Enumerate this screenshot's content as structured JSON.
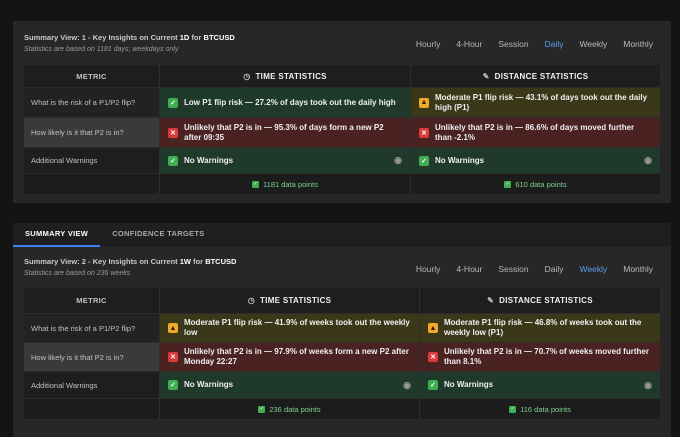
{
  "tabs": [
    {
      "label": "SUMMARY VIEW",
      "active": true
    },
    {
      "label": "CONFIDENCE TARGETS",
      "active": false
    }
  ],
  "timeframes": [
    "Hourly",
    "4-Hour",
    "Session",
    "Daily",
    "Weekly",
    "Monthly"
  ],
  "columns": {
    "metric": "METRIC",
    "time": "TIME STATISTICS",
    "distance": "DISTANCE STATISTICS"
  },
  "panels": [
    {
      "title_prefix": "Summary View: 1 - Key Insights on Current",
      "timeframe": "1D",
      "for_word": "for",
      "symbol": "BTCUSD",
      "subtitle": "Statistics are based on 1181 days; weekdays only",
      "active_timeframe": "Daily",
      "rows": [
        {
          "metric": "What is the risk of a P1/P2 flip?",
          "time": {
            "status": "ok",
            "text": "Low P1 flip risk — 27.2% of days took out the daily high"
          },
          "distance": {
            "status": "warn",
            "text": "Moderate P1 flip risk — 43.1% of days took out the daily high (P1)"
          }
        },
        {
          "metric": "How likely is it that P2 is in?",
          "time": {
            "status": "bad",
            "text": "Unlikely that P2 is in — 95.3% of days form a new P2 after 09:35"
          },
          "distance": {
            "status": "bad",
            "text": "Unlikely that P2 is in — 86.6% of days moved further than -2.1%"
          }
        },
        {
          "metric": "Additional Warnings",
          "time": {
            "status": "ok",
            "text": "No Warnings"
          },
          "distance": {
            "status": "ok",
            "text": "No Warnings"
          }
        }
      ],
      "footer": {
        "time": "1181 data points",
        "distance": "610 data points"
      }
    },
    {
      "title_prefix": "Summary View: 2 - Key Insights on Current",
      "timeframe": "1W",
      "for_word": "for",
      "symbol": "BTCUSD",
      "subtitle": "Statistics are based on 236 weeks",
      "active_timeframe": "Weekly",
      "rows": [
        {
          "metric": "What is the risk of a P1/P2 flip?",
          "time": {
            "status": "warn",
            "text": "Moderate P1 flip risk — 41.9% of weeks took out the weekly low"
          },
          "distance": {
            "status": "warn",
            "text": "Moderate P1 flip risk — 46.8% of weeks took out the weekly low (P1)"
          }
        },
        {
          "metric": "How likely is it that P2 is in?",
          "time": {
            "status": "bad",
            "text": "Unlikely that P2 is in — 97.9% of weeks form a new P2 after Monday 22:27"
          },
          "distance": {
            "status": "bad",
            "text": "Unlikely that P2 is in — 70.7% of weeks moved further than 8.1%"
          }
        },
        {
          "metric": "Additional Warnings",
          "time": {
            "status": "ok",
            "text": "No Warnings"
          },
          "distance": {
            "status": "ok",
            "text": "No Warnings"
          }
        }
      ],
      "footer": {
        "time": "236 data points",
        "distance": "116 data points"
      }
    }
  ],
  "icons": {
    "ok": "check-icon",
    "warn": "warning-triangle-icon",
    "bad": "x-icon",
    "eye": "eye-icon",
    "clock": "clock-icon",
    "ruler": "ruler-icon"
  },
  "colors": {
    "ok": "#3fae52",
    "warn": "#f0a92b",
    "bad": "#dc3b3b",
    "accent": "#3b82f6"
  }
}
